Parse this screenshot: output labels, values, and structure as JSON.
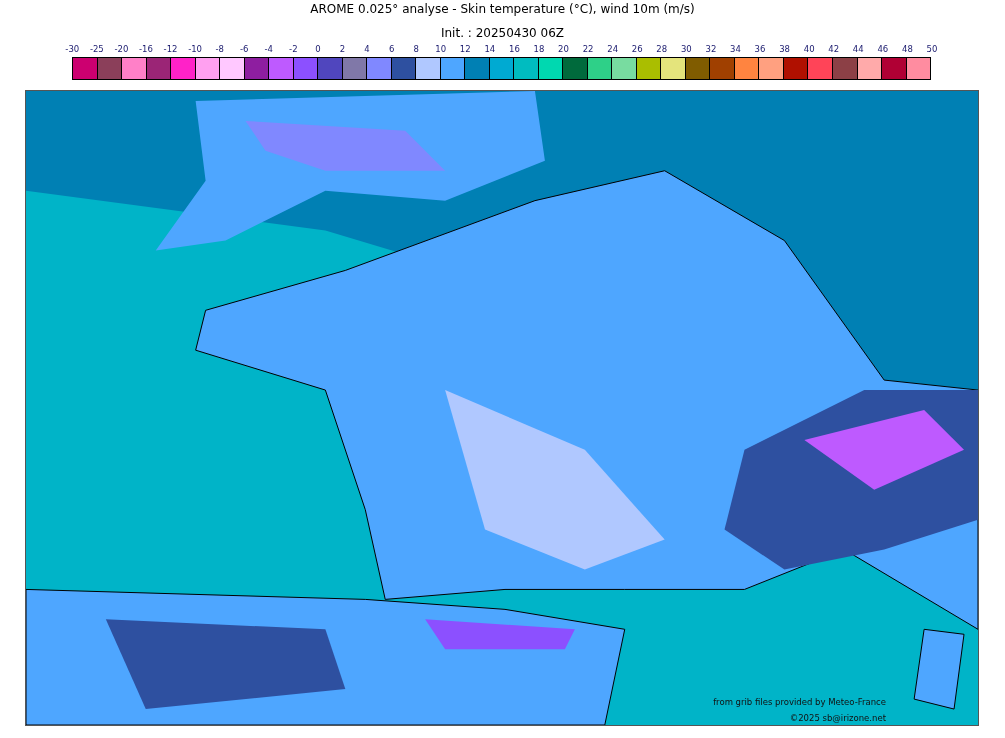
{
  "title": "AROME 0.025° analyse - Skin temperature (°C), wind 10m (m/s)",
  "subtitle": "Init. : 20250430 06Z",
  "colorbar": {
    "ticks": [
      "-30",
      "-25",
      "-20",
      "-16",
      "-12",
      "-10",
      "-8",
      "-6",
      "-4",
      "-2",
      "0",
      "2",
      "4",
      "6",
      "8",
      "10",
      "12",
      "14",
      "16",
      "18",
      "20",
      "22",
      "24",
      "26",
      "28",
      "30",
      "32",
      "34",
      "36",
      "38",
      "40",
      "42",
      "44",
      "46",
      "48",
      "50"
    ],
    "swatches": [
      {
        "color": "#cc0070"
      },
      {
        "color": "#8b3f5a"
      },
      {
        "color": "#ff80c8"
      },
      {
        "color": "#9b2576"
      },
      {
        "color": "#ff22c8"
      },
      {
        "color": "#ffa0f0"
      },
      {
        "color": "#ffc8ff"
      },
      {
        "color": "#8e1ea0"
      },
      {
        "color": "#be5aff"
      },
      {
        "color": "#8c50ff"
      },
      {
        "color": "#5046be"
      },
      {
        "color": "#8078a8"
      },
      {
        "color": "#8088ff"
      },
      {
        "color": "#2e50a0"
      },
      {
        "color": "#b0c8ff"
      },
      {
        "color": "#4ea6ff"
      },
      {
        "color": "#0080b4"
      },
      {
        "color": "#00aad2"
      },
      {
        "color": "#00bcc0"
      },
      {
        "color": "#00d8b0"
      },
      {
        "color": "#006a3c"
      },
      {
        "color": "#2ed088"
      },
      {
        "color": "#78dca0"
      },
      {
        "color": "#aabe00"
      },
      {
        "color": "#e4e47c"
      },
      {
        "color": "#805c00"
      },
      {
        "color": "#a04000"
      },
      {
        "color": "#ff8440"
      },
      {
        "color": "#ffa080"
      },
      {
        "color": "#b01000"
      },
      {
        "color": "#ff4458"
      },
      {
        "color": "#8c4046"
      },
      {
        "color": "#ffaaaa"
      },
      {
        "color": "#b00034"
      },
      {
        "color": "#ff8ca0"
      }
    ]
  },
  "map": {
    "credits": [
      "from grib files provided by Meteo-France",
      "©2025 sb@irizone.net"
    ]
  }
}
